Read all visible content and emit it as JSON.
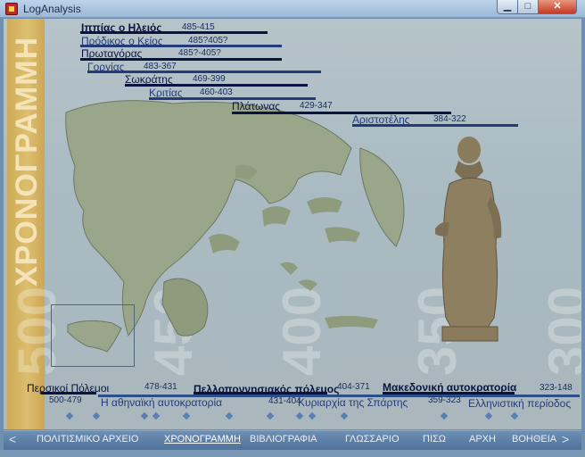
{
  "window": {
    "title": "LogAnalysis",
    "min_glyph": "▁",
    "max_glyph": "□",
    "close_glyph": "✕"
  },
  "sidebar": {
    "vertical_title": "ΧΡΟΝΟΓΡΑΜΜΗ"
  },
  "timeline": {
    "year_markers": [
      "500",
      "450",
      "400",
      "350",
      "300"
    ],
    "people": [
      {
        "name": "Ιππίας ο Ηλειός",
        "years": "485-415",
        "color": "#0b1340"
      },
      {
        "name": "Πρόδικος ο Κείος",
        "years": "485?405?",
        "color": "#243b7a"
      },
      {
        "name": "Πρωταγόρας",
        "years": "485?-405?",
        "color": "#0b1340"
      },
      {
        "name": "Γοργίας",
        "years": "483-367",
        "color": "#243b7a"
      },
      {
        "name": "Σωκράτης",
        "years": "469-399",
        "color": "#0b1340"
      },
      {
        "name": "Κριτίας",
        "years": "460-403",
        "color": "#243b7a"
      },
      {
        "name": "Πλάτωνας",
        "years": "429-347",
        "color": "#0b1340"
      },
      {
        "name": "Αριστοτέλης",
        "years": "384-322",
        "color": "#243b7a"
      }
    ],
    "events": [
      {
        "label": "Περσικοί Πόλεμοι",
        "years": "500-479",
        "color": "#0b1340"
      },
      {
        "label": "Πελλοποννησιακός πόλεμος",
        "years": "478-431",
        "color": "#0b1340"
      },
      {
        "label": "Μακεδονική αυτοκρατορία",
        "years": "404-371",
        "color": "#0b1340"
      },
      {
        "label": "Η αθηναϊκή αυτοκρατορία",
        "years": "431-404",
        "color": "#243b7a"
      },
      {
        "label": "Κυριαρχία της Σπάρτης",
        "years": "359-323",
        "color": "#243b7a"
      },
      {
        "label": "Ελληνιστική περίοδος",
        "years": "323-148",
        "color": "#243b7a"
      }
    ]
  },
  "nav": {
    "prev_glyph": "<",
    "next_glyph": ">",
    "items": [
      {
        "label": "ΠΟΛΙΤΙΣΜΙΚΟ ΑΡΧΕΙΟ"
      },
      {
        "label": "ΧΡΟΝΟΓΡΑΜΜΗ",
        "active": true
      },
      {
        "label": "ΒΙΒΛΙΟΓΡΑΦΙΑ"
      },
      {
        "label": "ΓΛΩΣΣΑΡΙΟ"
      },
      {
        "label": "ΠΙΣΩ"
      },
      {
        "label": "ΑΡΧΗ"
      },
      {
        "label": "ΒΟΗΘΕΙΑ"
      }
    ]
  }
}
